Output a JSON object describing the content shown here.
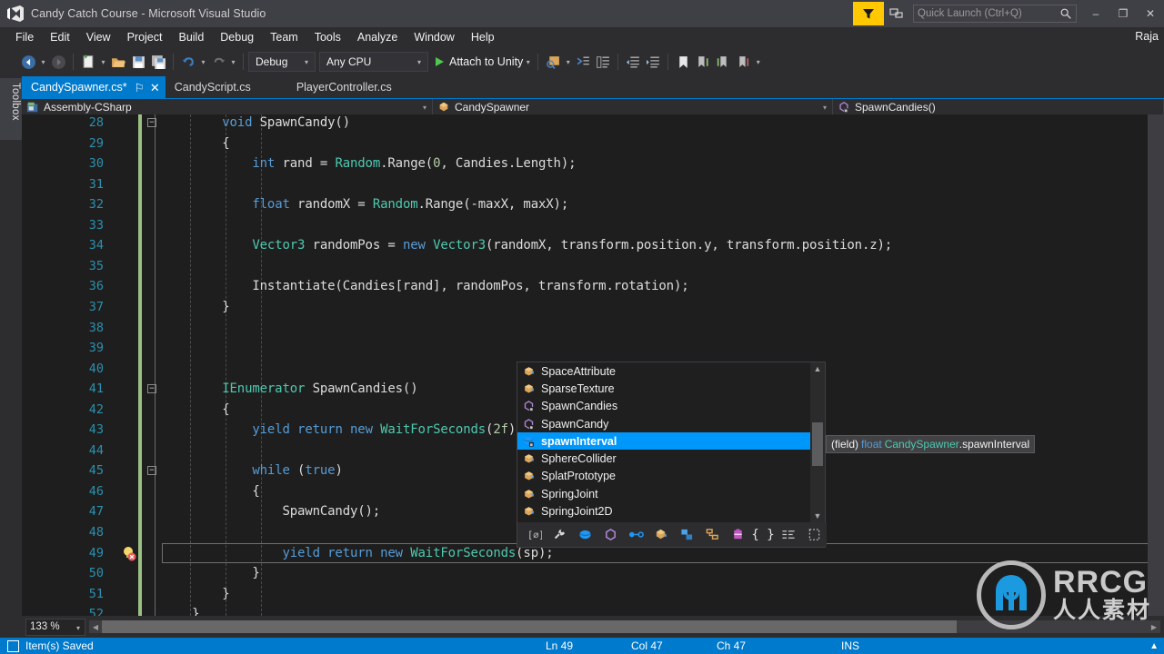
{
  "window": {
    "title": "Candy Catch Course - Microsoft Visual Studio",
    "user": "Raja",
    "minimize": "–",
    "maximize": "❐",
    "close": "✕"
  },
  "quick_launch": {
    "placeholder": "Quick Launch (Ctrl+Q)",
    "icon": "search-icon"
  },
  "menu": {
    "items": [
      "File",
      "Edit",
      "View",
      "Project",
      "Build",
      "Debug",
      "Team",
      "Tools",
      "Analyze",
      "Window",
      "Help"
    ]
  },
  "toolbar": {
    "back_icon": "navigate-back-icon",
    "forward_icon": "navigate-forward-icon",
    "new_project_icon": "new-project-icon",
    "open_file_icon": "open-file-icon",
    "save_icon": "save-icon",
    "save_all_icon": "save-all-icon",
    "undo_icon": "undo-icon",
    "redo_icon": "redo-icon",
    "configuration": "Debug",
    "platform": "Any CPU",
    "attach_label": "Attach to Unity",
    "find_icon": "find-in-files-icon",
    "comment_icon": "comment-selection-icon",
    "uncomment_icon": "uncomment-selection-icon",
    "indent_icon": "decrease-indent-icon",
    "outdent_icon": "increase-indent-icon",
    "bookmark_icon": "toggle-bookmark-icon",
    "prev_bookmark_icon": "previous-bookmark-icon",
    "next_bookmark_icon": "next-bookmark-icon",
    "clear_bookmarks_icon": "clear-bookmarks-icon",
    "overflow_icon": "toolbar-overflow-icon"
  },
  "toolbox": {
    "label": "Toolbox"
  },
  "tabs": [
    {
      "label": "CandySpawner.cs*",
      "active": true,
      "pin": "⚐",
      "close": "✕"
    },
    {
      "label": "CandyScript.cs",
      "active": false
    },
    {
      "label": "PlayerController.cs",
      "active": false
    }
  ],
  "navbar": {
    "project": "Assembly-CSharp",
    "project_icon": "project-icon",
    "type": "CandySpawner",
    "type_icon": "class-icon",
    "member": "SpawnCandies()",
    "member_icon": "method-icon"
  },
  "editor": {
    "zoom": "133 %",
    "lines": [
      {
        "no": "28",
        "fold": "−",
        "tokens": [
          {
            "t": "        ",
            "c": "p"
          },
          {
            "t": "void",
            "c": "k"
          },
          {
            "t": " SpawnCandy()",
            "c": "p"
          }
        ]
      },
      {
        "no": "29",
        "tokens": [
          {
            "t": "        {",
            "c": "p"
          }
        ]
      },
      {
        "no": "30",
        "tokens": [
          {
            "t": "            ",
            "c": "p"
          },
          {
            "t": "int",
            "c": "k"
          },
          {
            "t": " rand = ",
            "c": "p"
          },
          {
            "t": "Random",
            "c": "t"
          },
          {
            "t": ".Range(",
            "c": "p"
          },
          {
            "t": "0",
            "c": "s"
          },
          {
            "t": ", Candies.Length);",
            "c": "p"
          }
        ]
      },
      {
        "no": "31",
        "tokens": []
      },
      {
        "no": "32",
        "tokens": [
          {
            "t": "            ",
            "c": "p"
          },
          {
            "t": "float",
            "c": "k"
          },
          {
            "t": " randomX = ",
            "c": "p"
          },
          {
            "t": "Random",
            "c": "t"
          },
          {
            "t": ".Range(-maxX, maxX);",
            "c": "p"
          }
        ]
      },
      {
        "no": "33",
        "tokens": []
      },
      {
        "no": "34",
        "tokens": [
          {
            "t": "            ",
            "c": "p"
          },
          {
            "t": "Vector3",
            "c": "t"
          },
          {
            "t": " randomPos = ",
            "c": "p"
          },
          {
            "t": "new",
            "c": "k"
          },
          {
            "t": " ",
            "c": "p"
          },
          {
            "t": "Vector3",
            "c": "t"
          },
          {
            "t": "(randomX, transform.position.y, transform.position.z);",
            "c": "p"
          }
        ]
      },
      {
        "no": "35",
        "tokens": []
      },
      {
        "no": "36",
        "tokens": [
          {
            "t": "            Instantiate(Candies[rand], randomPos, transform.rotation);",
            "c": "p"
          }
        ]
      },
      {
        "no": "37",
        "tokens": [
          {
            "t": "        }",
            "c": "p"
          }
        ]
      },
      {
        "no": "38",
        "tokens": []
      },
      {
        "no": "39",
        "tokens": []
      },
      {
        "no": "40",
        "tokens": []
      },
      {
        "no": "41",
        "fold": "−",
        "tokens": [
          {
            "t": "        ",
            "c": "p"
          },
          {
            "t": "IEnumerator",
            "c": "t"
          },
          {
            "t": " SpawnCandies()",
            "c": "p"
          }
        ]
      },
      {
        "no": "42",
        "tokens": [
          {
            "t": "        {",
            "c": "p"
          }
        ]
      },
      {
        "no": "43",
        "tokens": [
          {
            "t": "            ",
            "c": "p"
          },
          {
            "t": "yield",
            "c": "k"
          },
          {
            "t": " ",
            "c": "p"
          },
          {
            "t": "return",
            "c": "k"
          },
          {
            "t": " ",
            "c": "p"
          },
          {
            "t": "new",
            "c": "k"
          },
          {
            "t": " ",
            "c": "p"
          },
          {
            "t": "WaitForSeconds",
            "c": "t"
          },
          {
            "t": "(",
            "c": "p"
          },
          {
            "t": "2f",
            "c": "s"
          },
          {
            "t": ");",
            "c": "p"
          }
        ]
      },
      {
        "no": "44",
        "tokens": []
      },
      {
        "no": "45",
        "fold": "−",
        "tokens": [
          {
            "t": "            ",
            "c": "p"
          },
          {
            "t": "while",
            "c": "k"
          },
          {
            "t": " (",
            "c": "p"
          },
          {
            "t": "true",
            "c": "k"
          },
          {
            "t": ")",
            "c": "p"
          }
        ]
      },
      {
        "no": "46",
        "tokens": [
          {
            "t": "            {",
            "c": "p"
          }
        ]
      },
      {
        "no": "47",
        "tokens": [
          {
            "t": "                SpawnCandy();",
            "c": "p"
          }
        ]
      },
      {
        "no": "48",
        "tokens": []
      },
      {
        "no": "49",
        "current": true,
        "bulb": "lightbulb-error-icon",
        "tokens": [
          {
            "t": "                ",
            "c": "p"
          },
          {
            "t": "yield",
            "c": "k"
          },
          {
            "t": " ",
            "c": "p"
          },
          {
            "t": "return",
            "c": "k"
          },
          {
            "t": " ",
            "c": "p"
          },
          {
            "t": "new",
            "c": "k"
          },
          {
            "t": " ",
            "c": "p"
          },
          {
            "t": "WaitForSeconds",
            "c": "t"
          },
          {
            "t": "(sp);",
            "c": "p"
          }
        ]
      },
      {
        "no": "50",
        "tokens": [
          {
            "t": "            }",
            "c": "p"
          }
        ]
      },
      {
        "no": "51",
        "tokens": [
          {
            "t": "        }",
            "c": "p"
          }
        ]
      },
      {
        "no": "52",
        "tokens": [
          {
            "t": "    }",
            "c": "p"
          }
        ]
      }
    ]
  },
  "intellisense": {
    "items": [
      {
        "label": "SpaceAttribute",
        "icon": "class-icon",
        "selected": false
      },
      {
        "label": "SparseTexture",
        "icon": "class-icon",
        "selected": false
      },
      {
        "label": "SpawnCandies",
        "icon": "method-icon",
        "selected": false
      },
      {
        "label": "SpawnCandy",
        "icon": "method-icon",
        "selected": false
      },
      {
        "label": "spawnInterval",
        "icon": "field-icon",
        "selected": true
      },
      {
        "label": "SphereCollider",
        "icon": "class-icon",
        "selected": false
      },
      {
        "label": "SplatPrototype",
        "icon": "class-icon",
        "selected": false
      },
      {
        "label": "SpringJoint",
        "icon": "class-icon",
        "selected": false
      },
      {
        "label": "SpringJoint2D",
        "icon": "class-icon",
        "selected": false
      }
    ],
    "scroll_up": "▲",
    "scroll_down": "▼",
    "filter_tabs": [
      "common-icon",
      "wrench-icon",
      "namespace-icon",
      "class-icon",
      "enum-icon",
      "interface-icon",
      "struct-icon",
      "event-icon",
      "delegate-icon",
      "braces-icon",
      "properties-icon",
      "snippet-icon"
    ],
    "tooltip": {
      "prefix": "(field) ",
      "keyword": "float",
      "type": " CandySpawner",
      "member": ".spawnInterval"
    }
  },
  "statusbar": {
    "message": "Item(s) Saved",
    "message_icon": "save-state-icon",
    "line": "Ln 49",
    "column": "Col 47",
    "character": "Ch 47",
    "insert_mode": "INS",
    "notify_icon": "▲"
  },
  "watermark": {
    "brand": "RRCG",
    "brand_cn": "人人素材"
  },
  "colors": {
    "accent": "#007acc",
    "titlebar": "#3f3f46",
    "chrome": "#2d2d30",
    "editor_bg": "#1e1e1e",
    "linenumber": "#2b91af",
    "keyword": "#569cd6",
    "type": "#4ec9b0",
    "number": "#b5cea8",
    "plain": "#dcdcdc",
    "saved_track": "#9bc083",
    "selection": "#0097fb",
    "filter_yellow": "#ffc800"
  }
}
